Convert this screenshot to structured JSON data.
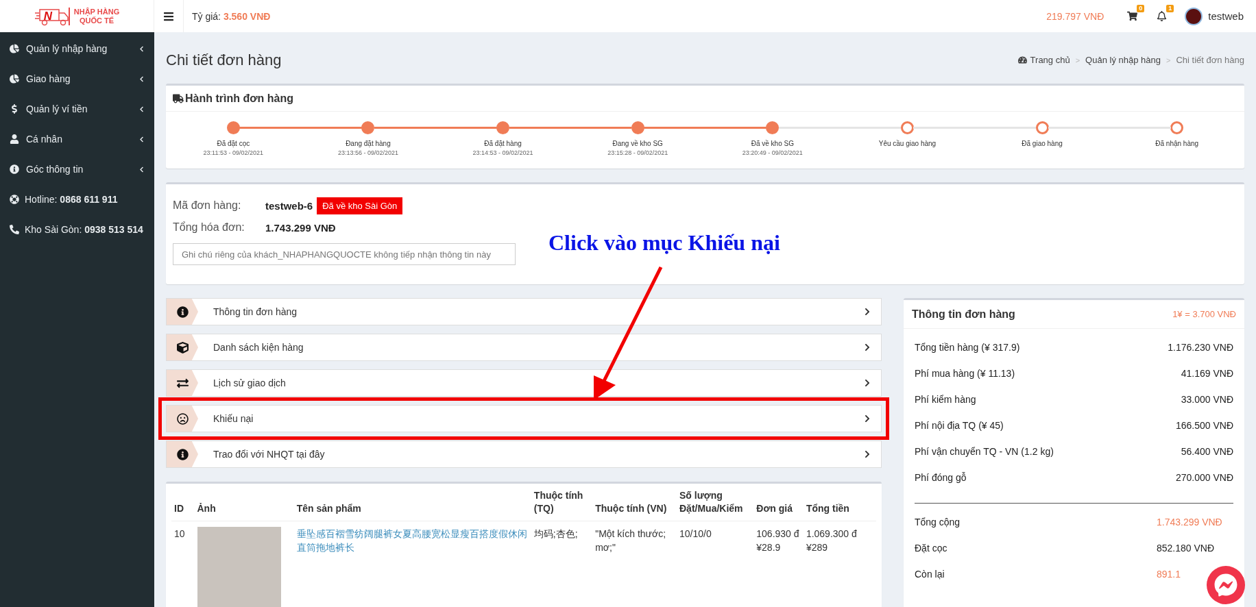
{
  "logo": {
    "mark": "N",
    "line1": "NHẬP HÀNG",
    "line2": "QUỐC TẾ"
  },
  "header": {
    "rate_label": "Tỷ giá:",
    "rate_value": "3.560 VNĐ",
    "balance": "219.797 VNĐ",
    "cart_count": "0",
    "bell_count": "1",
    "username": "testweb"
  },
  "sidebar": {
    "items": [
      {
        "kind": "pie",
        "label": "Quản lý nhập hàng"
      },
      {
        "kind": "pie",
        "label": "Giao hàng"
      },
      {
        "kind": "dollar",
        "label": "Quản lý ví tiền"
      },
      {
        "kind": "user",
        "label": "Cá nhân"
      },
      {
        "kind": "info",
        "label": "Góc thông tin"
      }
    ],
    "contacts": [
      {
        "kind": "lifering",
        "label": "Hotline:",
        "value": "0868 611 911"
      },
      {
        "kind": "phone",
        "label": "Kho Sài Gòn:",
        "value": "0938 513 514"
      }
    ]
  },
  "page": {
    "title": "Chi tiết đơn hàng",
    "breadcrumb": [
      "Trang chủ",
      "Quản lý nhập hàng",
      "Chi tiết đơn hàng"
    ],
    "separator": ">"
  },
  "journey": {
    "title": "Hành trình đơn hàng",
    "steps": [
      {
        "label": "Đã đặt cọc",
        "time": "23:11:53 - 09/02/2021",
        "done": true
      },
      {
        "label": "Đang đặt hàng",
        "time": "23:13:56 - 09/02/2021",
        "done": true
      },
      {
        "label": "Đã đặt hàng",
        "time": "23:14:53 - 09/02/2021",
        "done": true
      },
      {
        "label": "Đang về kho SG",
        "time": "23:15:28 - 09/02/2021",
        "done": true
      },
      {
        "label": "Đã về kho SG",
        "time": "23:20:49 - 09/02/2021",
        "done": true
      },
      {
        "label": "Yêu cầu giao hàng",
        "done": false
      },
      {
        "label": "Đã giao hàng",
        "done": false
      },
      {
        "label": "Đã nhận hàng",
        "done": false
      }
    ]
  },
  "order": {
    "code_label": "Mã đơn hàng:",
    "code": "testweb-6",
    "status": "Đã về kho Sài Gòn",
    "total_label": "Tổng hóa đơn:",
    "total": "1.743.299 VNĐ",
    "note_placeholder": "Ghi chú riêng của khách_NHAPHANGQUOCTE không tiếp nhận thông tin này"
  },
  "annotation": {
    "text": "Click vào mục Khiếu nại"
  },
  "sections": [
    {
      "kind": "info",
      "label": "Thông tin đơn hàng",
      "highlighted": false
    },
    {
      "kind": "cube",
      "label": "Danh sách kiện hàng",
      "highlighted": false
    },
    {
      "kind": "exchange",
      "label": "Lịch sử giao dịch",
      "highlighted": false
    },
    {
      "kind": "frown",
      "label": "Khiếu nại",
      "highlighted": true
    },
    {
      "kind": "info",
      "label": "Trao đổi với NHQT tại đây",
      "highlighted": false
    }
  ],
  "table": {
    "columns": [
      "ID",
      "Ảnh",
      "Tên sản phẩm",
      "Thuộc tính (TQ)",
      "Thuộc tính (VN)",
      "Số lượng Đặt/Mua/Kiểm",
      "Đơn giá",
      "Tổng tiền"
    ],
    "rows": [
      {
        "id": "10",
        "name": "垂坠感百褶雪纺阔腿裤女夏高腰宽松显瘦百搭度假休闲直筒拖地裤长",
        "attr_tq": "均码;杏色;",
        "attr_vn": "\"Một kích thước; mơ;\"",
        "qty": "10/10/0",
        "price": [
          "106.930 đ",
          "¥28.9"
        ],
        "total": [
          "1.069.300 đ",
          "¥289"
        ]
      }
    ]
  },
  "summary": {
    "title": "Thông tin đơn hàng",
    "rate": "1¥ = 3.700 VNĐ",
    "fees": [
      {
        "label": "Tổng tiền hàng (¥ 317.9)",
        "value": "1.176.230 VNĐ"
      },
      {
        "label": "Phí mua hàng (¥ 11.13)",
        "value": "41.169 VNĐ"
      },
      {
        "label": "Phí kiểm hàng",
        "value": "33.000 VNĐ"
      },
      {
        "label": "Phí nội địa TQ (¥ 45)",
        "value": "166.500 VNĐ"
      },
      {
        "label": "Phí vận chuyển TQ - VN (1.2 kg)",
        "value": "56.400 VNĐ"
      },
      {
        "label": "Phí đóng gỗ",
        "value": "270.000 VNĐ"
      }
    ],
    "totals": [
      {
        "label": "Tổng cộng",
        "value": "1.743.299 VNĐ",
        "highlight": true
      },
      {
        "label": "Đặt cọc",
        "value": "852.180 VNĐ",
        "highlight": false
      },
      {
        "label": "Còn lại",
        "value": "891.1",
        "highlight": true
      }
    ]
  }
}
